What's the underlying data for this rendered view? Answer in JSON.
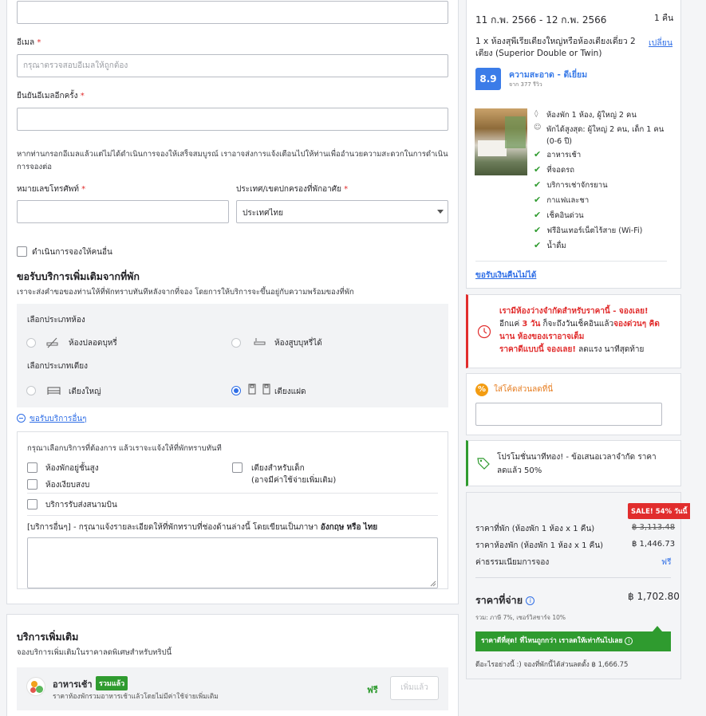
{
  "form": {
    "email_label": "อีเมล",
    "email_placeholder": "กรุณาตรวจสอบอีเมลให้ถูกต้อง",
    "confirm_email_label": "ยืนยันอีเมลอีกครั้ง",
    "required_mark": "*",
    "email_notice": "หากท่านกรอกอีเมลแล้วแต่ไม่ได้ดำเนินการจองให้เสร็จสมบูรณ์ เราอาจส่งการแจ้งเตือนไปให้ท่านเพื่ออำนวยความสะดวกในการดำเนินการจองต่อ",
    "phone_label": "หมายเลขโทรศัพท์",
    "country_label": "ประเทศ/เขตปกครองที่พักอาศัย",
    "country_value": "ประเทศไทย",
    "book_for_other_label": "ดำเนินการจองให้คนอื่น"
  },
  "special_requests": {
    "title": "ขอรับบริการเพิ่มเติมจากที่พัก",
    "subtitle": "เราจะส่งคำขอของท่านให้ที่พักทราบทันทีหลังจากที่จอง โดยการให้บริการจะขึ้นอยู่กับความพร้อมของที่พัก",
    "room_type_label": "เลือกประเภทห้อง",
    "non_smoking": "ห้องปลอดบุหรี่",
    "smoking": "ห้องสูบบุหรี่ได้",
    "bed_type_label": "เลือกประเภทเตียง",
    "large_bed": "เตียงใหญ่",
    "twin_bed": "เตียงแฝด",
    "other_toggle": "ขอรับบริการอื่นๆ",
    "other_intro": "กรุณาเลือกบริการที่ต้องการ แล้วเราจะแจ้งให้ที่พักทราบทันที",
    "high_floor": "ห้องพักอยู่ชั้นสูง",
    "quiet_room": "ห้องเงียบสงบ",
    "airport_transfer": "บริการรับส่งสนามบิน",
    "baby_cot": "เตียงสำหรับเด็ก",
    "baby_cot_note": "(อาจมีค่าใช้จ่ายเพิ่มเติม)",
    "other_text_prefix": "[บริการอื่นๆ] - กรุณาแจ้งรายละเอียดให้ที่พักทราบที่ช่องด้านล่างนี้ โดยเขียนเป็นภาษา",
    "lang_en": "อังกฤษ",
    "lang_or": "หรือ",
    "lang_th": "ไทย"
  },
  "addons": {
    "title": "บริการเพิ่มเติม",
    "subtitle": "จองบริการเพิ่มเติมในราคาลดพิเศษสำหรับทริปนี้",
    "breakfast_title": "อาหารเช้า",
    "breakfast_badge": "รวมแล้ว",
    "breakfast_desc": "ราคาห้องพักรวมอาหารเช้าแล้วโดยไม่มีค่าใช้จ่ายเพิ่มเติม",
    "breakfast_price": "ฟรี",
    "added_button": "เพิ่มแล้ว"
  },
  "summary": {
    "dates": "11 ก.พ. 2566 - 12 ก.พ. 2566",
    "nights": "1 คืน",
    "room_line1": "1 x ห้องสุพีเรียเตียงใหญ่หรือห้องเตียงเดี่ยว 2",
    "room_line2": "เตียง (Superior Double or Twin)",
    "change_link": "เปลี่ยน",
    "score": "8.9",
    "score_label": "ความสะอาด - ดีเยี่ยม",
    "score_reviews": "จาก 377 รีวิว",
    "occupancy": "ห้องพัก 1 ห้อง, ผู้ใหญ่ 2 คน",
    "max_occ_line1": "พักได้สูงสุด: ผู้ใหญ่ 2 คน, เด็ก 1 คน",
    "max_occ_line2": "(0-6 ปี)",
    "amenities": [
      "อาหารเช้า",
      "ที่จอดรถ",
      "บริการเช่าจักรยาน",
      "กาแฟและชา",
      "เช็คอินด่วน",
      "ฟรีอินเทอร์เน็ตไร้สาย (Wi-Fi)",
      "น้ำดื่ม"
    ],
    "refund": "ขอรับเงินคืนไม่ได้"
  },
  "urgency": {
    "line1": "เรามีห้องว่างจำกัดสำหรับราคานี้ - จองเลย!",
    "line2_a": "อีกแค่",
    "line2_num": "3 วัน",
    "line2_b": "ก็จะถึงวันเช็คอินแล้ว",
    "line2_c": "จองด่วนๆ คิด",
    "line3": "นาน ห้องของเราอาจเต็ม",
    "line4_a": "ราคาดีแบบนี้ จองเลย!",
    "line4_b": "ลดแรง นาทีสุดท้าย"
  },
  "promo": {
    "link": "ใส่โค้ดส่วนลดที่นี่",
    "banner": "โปรโมชั่นนาทีทอง! - ข้อเสนอเวลาจำกัด ราคาลดแล้ว 50%"
  },
  "price": {
    "sale_badge": "SALE! 54% วันนี้",
    "original_label": "ราคาที่พัก (ห้องพัก 1 ห้อง x 1 คืน)",
    "original_value": "฿ 3,113.48",
    "room_label": "ราคาห้องพัก (ห้องพัก 1 ห้อง x 1 คืน)",
    "room_value": "฿ 1,446.73",
    "fee_label": "ค่าธรรมเนียมการจอง",
    "fee_value": "ฟรี",
    "total_label": "ราคาที่จ่าย",
    "total_value": "฿ 1,702.80",
    "total_note": "รวม: ภาษี 7%, เซอร์วิสชาร์จ 10%",
    "best_price": "ราคาดีที่สุด! ที่ไหนถูกกว่า เราลดให้เท่ากันไปเลย",
    "footer": "ดีอะไรอย่างนี้ :) จองที่พักนี้ได้ส่วนลดตั้ง ฿ 1,666.75"
  }
}
